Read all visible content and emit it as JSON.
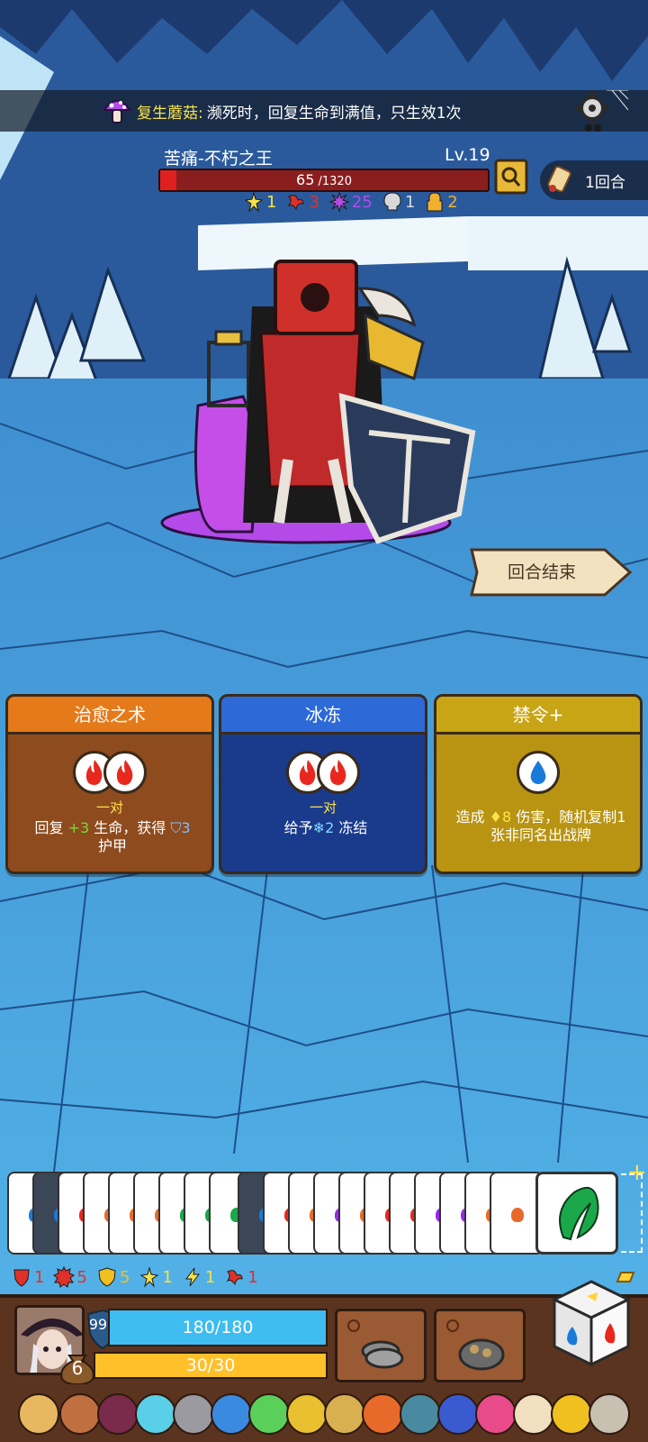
{
  "relic_banner": {
    "name": "复生蘑菇:",
    "description": "濒死时，回复生命到满值，只生效1次"
  },
  "enemy": {
    "name": "苦痛-不朽之王",
    "level": "Lv.19",
    "hp_current": "65",
    "hp_max": " /1320",
    "hp_fraction": 0.049,
    "statuses": [
      {
        "icon": "star-burst-icon",
        "value": "1",
        "color": "#f6e24a"
      },
      {
        "icon": "bleed-icon",
        "value": "3",
        "color": "#e0302a"
      },
      {
        "icon": "poison-splat-icon",
        "value": "25",
        "color": "#b44ae8"
      },
      {
        "icon": "skull-icon",
        "value": "1",
        "color": "#d8d8d8"
      },
      {
        "icon": "lock-icon",
        "value": "2",
        "color": "#f0b030"
      }
    ]
  },
  "round": {
    "label": "1回合"
  },
  "end_turn": {
    "label": "回合结束"
  },
  "cards": [
    {
      "title": "治愈之术",
      "requirement": "一对",
      "slots": [
        "fire",
        "fire"
      ],
      "desc_parts": [
        "回复 ",
        "+3",
        " 生命，获得 ",
        "3",
        "\n护甲"
      ]
    },
    {
      "title": "冰冻",
      "requirement": "一对",
      "slots": [
        "fire",
        "fire"
      ],
      "desc_parts": [
        "给予",
        "2",
        " 冻结"
      ]
    },
    {
      "title": "禁令+",
      "requirement": "",
      "slots": [
        "water"
      ],
      "desc_parts": [
        "造成 ",
        "8",
        " 伤害，随机复制1",
        "张非同名出战牌"
      ]
    }
  ],
  "player_stats": [
    {
      "icon": "attack-shield-icon",
      "value": "1",
      "color": "#e0302a"
    },
    {
      "icon": "spiked-gear-icon",
      "value": "5",
      "color": "#e0302a"
    },
    {
      "icon": "shield-icon",
      "value": "5",
      "color": "#f0c020"
    },
    {
      "icon": "star-burst-icon",
      "value": "1",
      "color": "#f6e24a"
    },
    {
      "icon": "lightning-icon",
      "value": "1",
      "color": "#f6e24a"
    },
    {
      "icon": "bleed-icon",
      "value": "1",
      "color": "#e0302a"
    }
  ],
  "player": {
    "armor": "991",
    "level": "6",
    "hp": "180/180",
    "energy": "30/30"
  },
  "colors": {
    "fire": "#e8281e",
    "water": "#1a7ad8",
    "leaf": "#1aa84a"
  }
}
